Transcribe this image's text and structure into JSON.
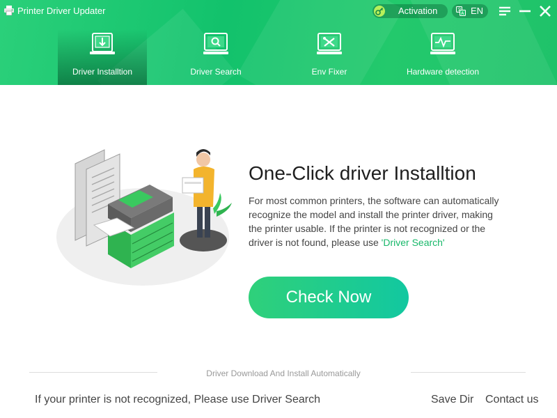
{
  "app": {
    "title": "Printer Driver Updater"
  },
  "titlebar": {
    "activation_label": "Activation",
    "language_label": "EN"
  },
  "tabs": [
    {
      "label": "Driver Installtion",
      "icon": "download-icon",
      "active": true
    },
    {
      "label": "Driver Search",
      "icon": "monitor-search-icon",
      "active": false
    },
    {
      "label": "Env Fixer",
      "icon": "tools-icon",
      "active": false
    },
    {
      "label": "Hardware detection",
      "icon": "pulse-monitor-icon",
      "active": false
    }
  ],
  "main": {
    "heading": "One-Click driver Installtion",
    "description": "For most common printers, the software can automatically recognize the model and install the printer driver, making the printer usable. If the printer is not recognized or the driver is not found, please use ",
    "description_link": "'Driver Search'",
    "check_button": "Check Now"
  },
  "footer": {
    "caption": "Driver Download And Install Automatically",
    "hint": "If your printer is not recognized, Please use Driver Search",
    "save_dir": "Save Dir",
    "contact": "Contact us"
  },
  "colors": {
    "brand_green": "#1fc26a",
    "link_green": "#18b86a",
    "button_start": "#2fd07a",
    "button_end": "#12c8a0"
  }
}
